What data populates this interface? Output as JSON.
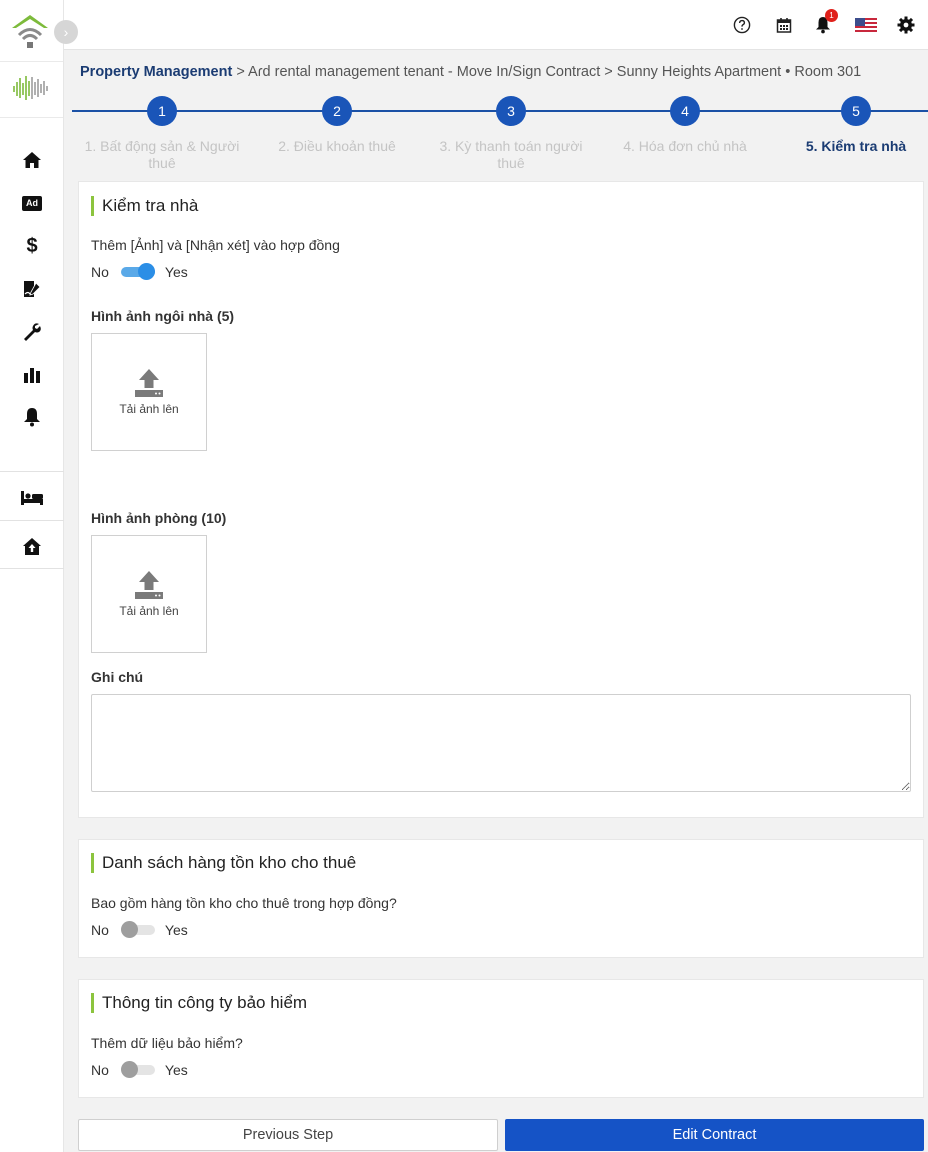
{
  "sidebar": {
    "expand_glyph": "›",
    "items": [
      {
        "icon": "home-icon"
      },
      {
        "icon": "ad-icon",
        "label": "Ad"
      },
      {
        "icon": "dollar-icon",
        "label": "$"
      },
      {
        "icon": "sign-contract-icon"
      },
      {
        "icon": "wrench-icon"
      },
      {
        "icon": "bar-chart-icon"
      },
      {
        "icon": "bell-icon"
      },
      {
        "icon": "bed-icon"
      },
      {
        "icon": "house-upload-icon"
      }
    ]
  },
  "topbar": {
    "icons": [
      "help-icon",
      "calendar-icon",
      "notification-bell-icon",
      "us-flag-icon",
      "settings-icon"
    ],
    "notification_count": "1"
  },
  "breadcrumb": {
    "root": "Property Management",
    "sep": " > ",
    "level2": "Aɾd rental management tenant - Move In/Sign Contract",
    "level3": "Sunny Heights Apartment • Room 301"
  },
  "stepper": {
    "steps": [
      {
        "number": "1",
        "label": "1. Bất động sản & Người thuê"
      },
      {
        "number": "2",
        "label": "2. Điều khoản thuê"
      },
      {
        "number": "3",
        "label": "3. Kỳ thanh toán người thuê"
      },
      {
        "number": "4",
        "label": "4. Hóa đơn chủ nhà"
      },
      {
        "number": "5",
        "label": "5. Kiểm tra nhà"
      }
    ],
    "active_index": 4
  },
  "inspection": {
    "title": "Kiểm tra nhà",
    "toggle_question": "Thêm [Ảnh] và [Nhận xét] vào hợp đồng",
    "toggle_no": "No",
    "toggle_yes": "Yes",
    "toggle_on": true,
    "house_images_label": "Hình ảnh ngôi nhà (5)",
    "room_images_label": "Hình ảnh phòng (10)",
    "upload_label": "Tải ảnh lên",
    "notes_label": "Ghi chú",
    "notes_value": ""
  },
  "inventory": {
    "title": "Danh sách hàng tồn kho cho thuê",
    "question": "Bao gồm hàng tồn kho cho thuê trong hợp đồng?",
    "toggle_no": "No",
    "toggle_yes": "Yes",
    "toggle_on": false
  },
  "insurance": {
    "title": "Thông tin công ty bảo hiểm",
    "question": "Thêm dữ liệu bảo hiểm?",
    "toggle_no": "No",
    "toggle_yes": "Yes",
    "toggle_on": false
  },
  "actions": {
    "previous": "Previous Step",
    "edit": "Edit Contract"
  },
  "colors": {
    "primary": "#1553c6",
    "step": "#1a55b8",
    "accent_green": "#8cc43e",
    "breadcrumb_strong": "#1b3c73"
  }
}
